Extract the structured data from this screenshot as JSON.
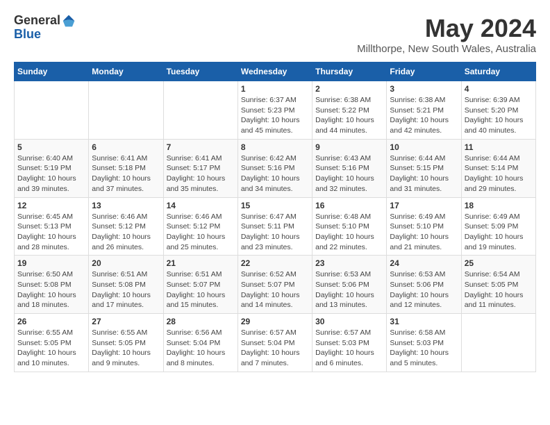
{
  "logo": {
    "general": "General",
    "blue": "Blue"
  },
  "title": {
    "month": "May 2024",
    "location": "Millthorpe, New South Wales, Australia"
  },
  "headers": [
    "Sunday",
    "Monday",
    "Tuesday",
    "Wednesday",
    "Thursday",
    "Friday",
    "Saturday"
  ],
  "weeks": [
    [
      {
        "day": "",
        "info": ""
      },
      {
        "day": "",
        "info": ""
      },
      {
        "day": "",
        "info": ""
      },
      {
        "day": "1",
        "info": "Sunrise: 6:37 AM\nSunset: 5:23 PM\nDaylight: 10 hours\nand 45 minutes."
      },
      {
        "day": "2",
        "info": "Sunrise: 6:38 AM\nSunset: 5:22 PM\nDaylight: 10 hours\nand 44 minutes."
      },
      {
        "day": "3",
        "info": "Sunrise: 6:38 AM\nSunset: 5:21 PM\nDaylight: 10 hours\nand 42 minutes."
      },
      {
        "day": "4",
        "info": "Sunrise: 6:39 AM\nSunset: 5:20 PM\nDaylight: 10 hours\nand 40 minutes."
      }
    ],
    [
      {
        "day": "5",
        "info": "Sunrise: 6:40 AM\nSunset: 5:19 PM\nDaylight: 10 hours\nand 39 minutes."
      },
      {
        "day": "6",
        "info": "Sunrise: 6:41 AM\nSunset: 5:18 PM\nDaylight: 10 hours\nand 37 minutes."
      },
      {
        "day": "7",
        "info": "Sunrise: 6:41 AM\nSunset: 5:17 PM\nDaylight: 10 hours\nand 35 minutes."
      },
      {
        "day": "8",
        "info": "Sunrise: 6:42 AM\nSunset: 5:16 PM\nDaylight: 10 hours\nand 34 minutes."
      },
      {
        "day": "9",
        "info": "Sunrise: 6:43 AM\nSunset: 5:16 PM\nDaylight: 10 hours\nand 32 minutes."
      },
      {
        "day": "10",
        "info": "Sunrise: 6:44 AM\nSunset: 5:15 PM\nDaylight: 10 hours\nand 31 minutes."
      },
      {
        "day": "11",
        "info": "Sunrise: 6:44 AM\nSunset: 5:14 PM\nDaylight: 10 hours\nand 29 minutes."
      }
    ],
    [
      {
        "day": "12",
        "info": "Sunrise: 6:45 AM\nSunset: 5:13 PM\nDaylight: 10 hours\nand 28 minutes."
      },
      {
        "day": "13",
        "info": "Sunrise: 6:46 AM\nSunset: 5:12 PM\nDaylight: 10 hours\nand 26 minutes."
      },
      {
        "day": "14",
        "info": "Sunrise: 6:46 AM\nSunset: 5:12 PM\nDaylight: 10 hours\nand 25 minutes."
      },
      {
        "day": "15",
        "info": "Sunrise: 6:47 AM\nSunset: 5:11 PM\nDaylight: 10 hours\nand 23 minutes."
      },
      {
        "day": "16",
        "info": "Sunrise: 6:48 AM\nSunset: 5:10 PM\nDaylight: 10 hours\nand 22 minutes."
      },
      {
        "day": "17",
        "info": "Sunrise: 6:49 AM\nSunset: 5:10 PM\nDaylight: 10 hours\nand 21 minutes."
      },
      {
        "day": "18",
        "info": "Sunrise: 6:49 AM\nSunset: 5:09 PM\nDaylight: 10 hours\nand 19 minutes."
      }
    ],
    [
      {
        "day": "19",
        "info": "Sunrise: 6:50 AM\nSunset: 5:08 PM\nDaylight: 10 hours\nand 18 minutes."
      },
      {
        "day": "20",
        "info": "Sunrise: 6:51 AM\nSunset: 5:08 PM\nDaylight: 10 hours\nand 17 minutes."
      },
      {
        "day": "21",
        "info": "Sunrise: 6:51 AM\nSunset: 5:07 PM\nDaylight: 10 hours\nand 15 minutes."
      },
      {
        "day": "22",
        "info": "Sunrise: 6:52 AM\nSunset: 5:07 PM\nDaylight: 10 hours\nand 14 minutes."
      },
      {
        "day": "23",
        "info": "Sunrise: 6:53 AM\nSunset: 5:06 PM\nDaylight: 10 hours\nand 13 minutes."
      },
      {
        "day": "24",
        "info": "Sunrise: 6:53 AM\nSunset: 5:06 PM\nDaylight: 10 hours\nand 12 minutes."
      },
      {
        "day": "25",
        "info": "Sunrise: 6:54 AM\nSunset: 5:05 PM\nDaylight: 10 hours\nand 11 minutes."
      }
    ],
    [
      {
        "day": "26",
        "info": "Sunrise: 6:55 AM\nSunset: 5:05 PM\nDaylight: 10 hours\nand 10 minutes."
      },
      {
        "day": "27",
        "info": "Sunrise: 6:55 AM\nSunset: 5:05 PM\nDaylight: 10 hours\nand 9 minutes."
      },
      {
        "day": "28",
        "info": "Sunrise: 6:56 AM\nSunset: 5:04 PM\nDaylight: 10 hours\nand 8 minutes."
      },
      {
        "day": "29",
        "info": "Sunrise: 6:57 AM\nSunset: 5:04 PM\nDaylight: 10 hours\nand 7 minutes."
      },
      {
        "day": "30",
        "info": "Sunrise: 6:57 AM\nSunset: 5:03 PM\nDaylight: 10 hours\nand 6 minutes."
      },
      {
        "day": "31",
        "info": "Sunrise: 6:58 AM\nSunset: 5:03 PM\nDaylight: 10 hours\nand 5 minutes."
      },
      {
        "day": "",
        "info": ""
      }
    ]
  ]
}
